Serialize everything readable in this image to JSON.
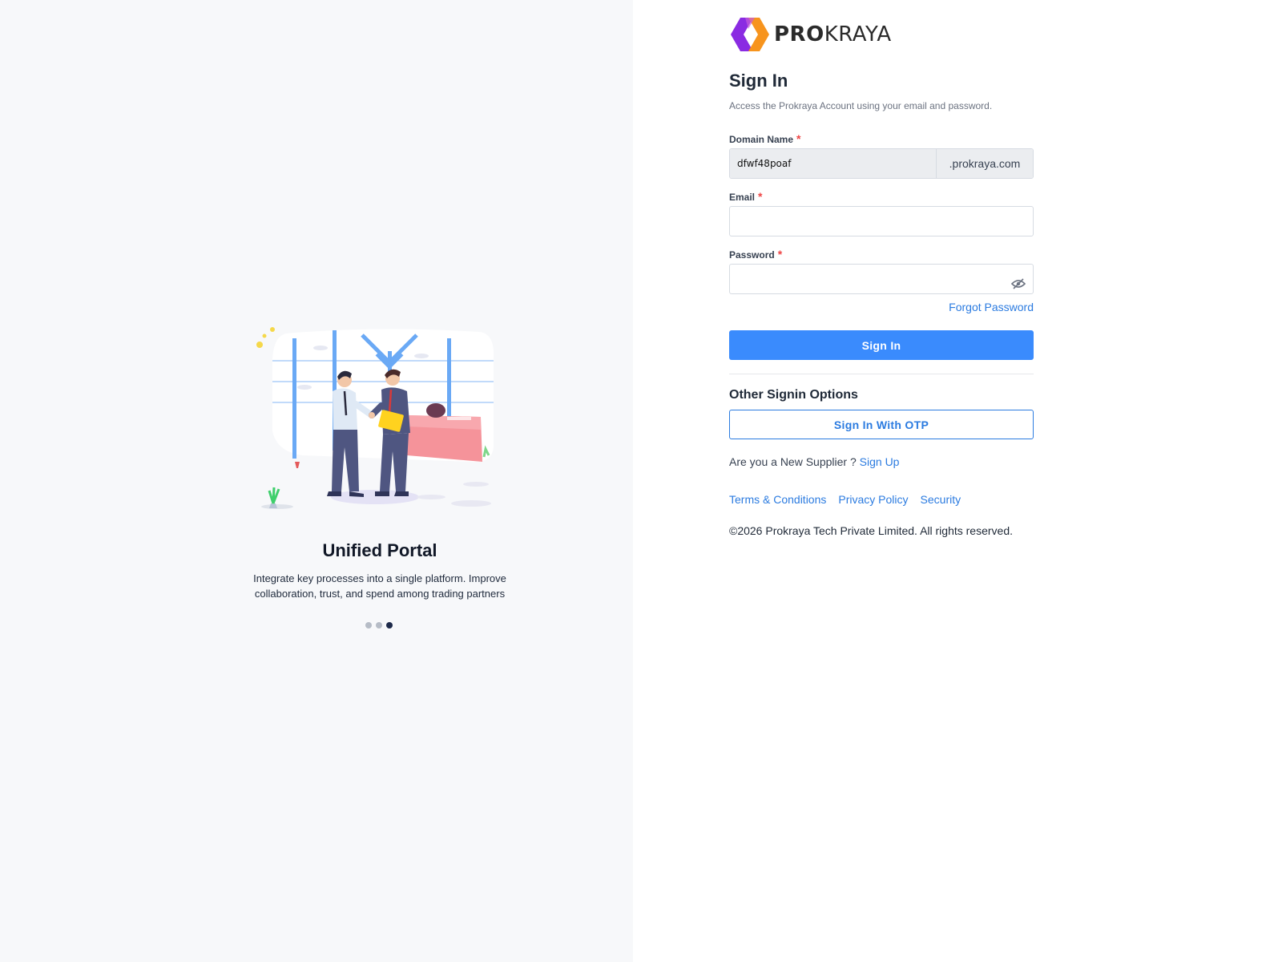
{
  "brand": {
    "name_bold": "PRO",
    "name_regular": "KRAYA",
    "colors": {
      "purple": "#8a2be2",
      "orange": "#f7941d",
      "primary": "#3a8bfd",
      "link": "#2b7be0"
    }
  },
  "carousel": {
    "title": "Unified Portal",
    "text": "Integrate key processes into a single platform. Improve collaboration, trust, and spend among trading partners",
    "active_slide": 3,
    "total_slides": 3
  },
  "form": {
    "title": "Sign In",
    "subtitle": "Access the Prokraya Account using your email and password.",
    "domain": {
      "label": "Domain Name",
      "required_mark": "*",
      "value": "dfwf48poaf",
      "suffix": ".prokraya.com"
    },
    "email": {
      "label": "Email",
      "required_mark": "*",
      "value": ""
    },
    "password": {
      "label": "Password",
      "required_mark": "*",
      "value": "",
      "toggle_icon": "eye-slash-icon"
    },
    "forgot_label": "Forgot Password",
    "submit_label": "Sign In"
  },
  "other_options": {
    "title": "Other Signin Options",
    "otp_label": "Sign In With OTP"
  },
  "supplier": {
    "prompt": "Are you a New Supplier ?",
    "link": "Sign Up"
  },
  "footer": {
    "links": [
      "Terms & Conditions",
      "Privacy Policy",
      "Security"
    ],
    "copyright": "©2026 Prokraya Tech Private Limited. All rights reserved."
  }
}
